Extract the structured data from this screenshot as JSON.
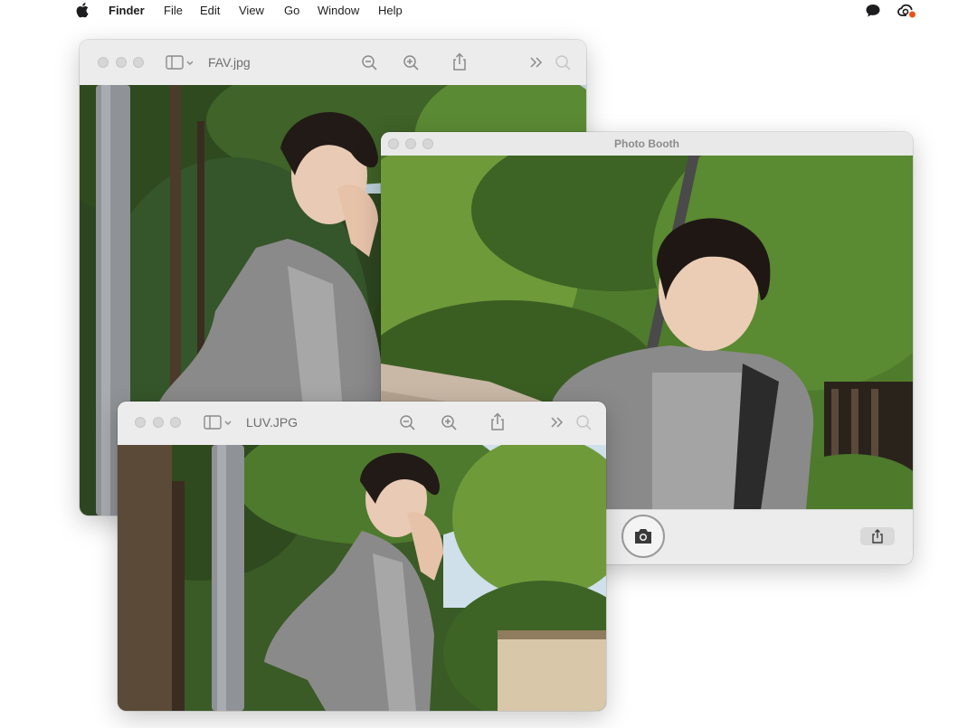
{
  "menubar": {
    "apple_icon": "apple-logo-icon",
    "app_name": "Finder",
    "items": [
      "File",
      "Edit",
      "View",
      "Go",
      "Window",
      "Help"
    ],
    "status_icons": [
      "messages-icon",
      "creative-cloud-icon"
    ]
  },
  "windows": {
    "fav": {
      "title": "FAV.jpg",
      "toolbar_icons": [
        "sidebar-toggle-icon",
        "zoom-out-icon",
        "zoom-in-icon",
        "share-icon",
        "more-icon",
        "search-icon"
      ]
    },
    "photo_booth": {
      "title": "Photo Booth",
      "controls": [
        "camera-shutter-icon",
        "share-icon"
      ]
    },
    "luv": {
      "title": "LUV.JPG",
      "toolbar_icons": [
        "sidebar-toggle-icon",
        "zoom-out-icon",
        "zoom-in-icon",
        "share-icon",
        "more-icon",
        "search-icon"
      ]
    }
  },
  "colors": {
    "toolbar_bg": "#ececec",
    "traffic_inactive": "#d6d6d6",
    "foliage_dark": "#2f4a1e",
    "foliage_light": "#6f9a3a",
    "hoodie": "#8a8a8a",
    "sky": "#cfe0ea"
  }
}
